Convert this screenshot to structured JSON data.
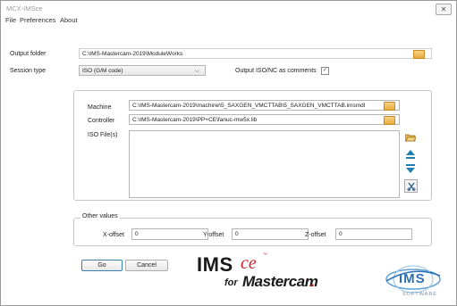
{
  "window": {
    "title": "MCX-IMSce",
    "close_glyph": "✕"
  },
  "menu": [
    "File",
    "Preferences",
    "About"
  ],
  "output_folder": {
    "label": "Output folder",
    "value": "C:\\IMS-Mastercam-2019\\ModuleWorks"
  },
  "session": {
    "label": "Session type",
    "value": "ISO (G/M code)",
    "arrow": "⌵"
  },
  "output_comments": {
    "label": "Output ISO/NC as comments",
    "checked": true,
    "check_glyph": "✓"
  },
  "machine": {
    "label": "Machine",
    "value": "C:\\IMS-Mastercam-2019\\machine\\5_SAXGEN_VMCTTAB\\5_SAXGEN_VMCTTAB.imsmdl"
  },
  "controller": {
    "label": "Controller",
    "value": "C:\\IMS-Mastercam-2019\\PP+CE\\fanuc-mw5x.lib"
  },
  "iso_files": {
    "label": "ISO File(s)",
    "items": []
  },
  "other_values": {
    "title": "Other values",
    "x_label": "X-offset",
    "x_value": "0",
    "y_label": "Y-offset",
    "y_value": "0",
    "z_label": "Z-offset",
    "z_value": "0"
  },
  "buttons": {
    "go": "Go",
    "cancel": "Cancel"
  },
  "branding": {
    "ims": "IMS",
    "ce": "ce",
    "tm": "™",
    "for": "for",
    "mastercam": "Mastercam",
    "dot": ".",
    "logo_text": "IMS",
    "software": "SOFTWARE",
    "red": "#d11f2a",
    "blue": "#2d6fb6"
  }
}
